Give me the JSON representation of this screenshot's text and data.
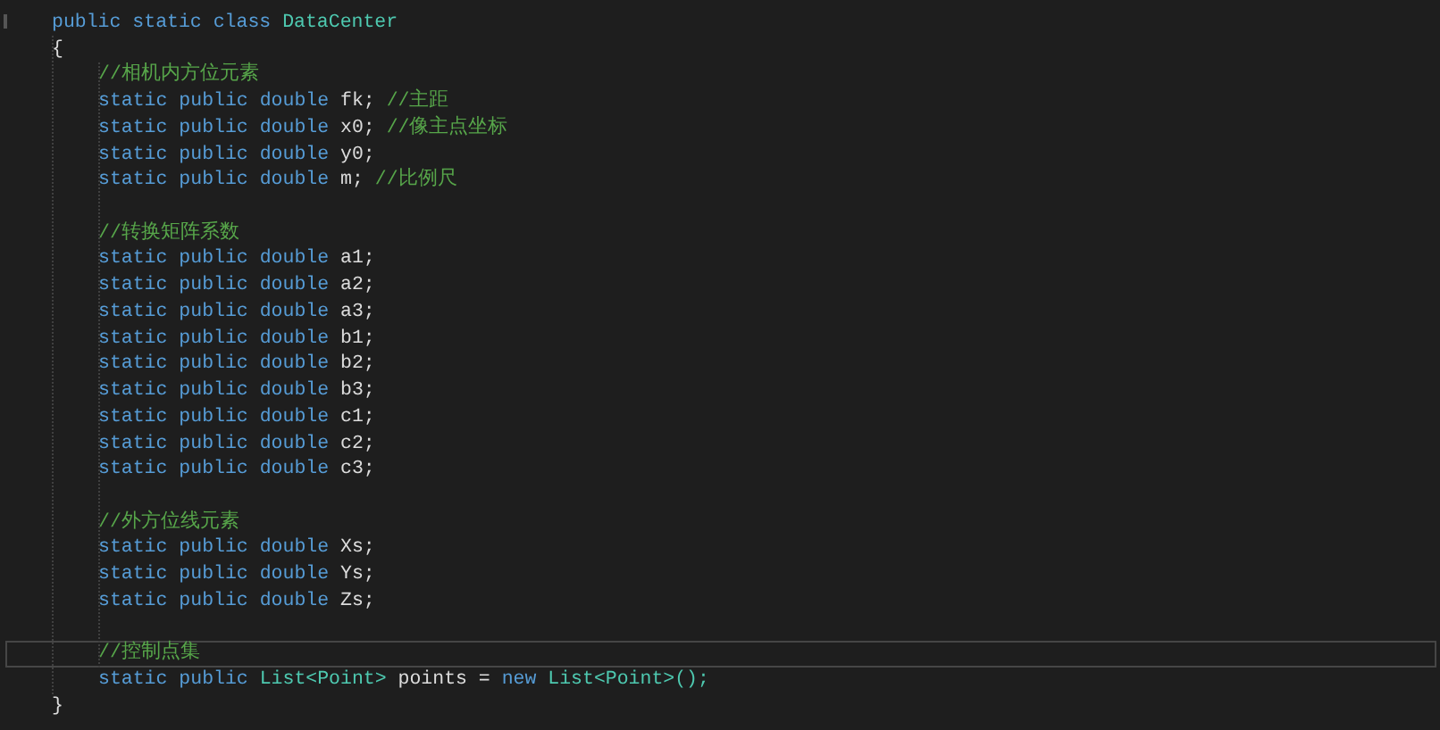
{
  "header": [
    {
      "kind": "keyword",
      "text": "public"
    },
    {
      "kind": "keyword",
      "text": "static"
    },
    {
      "kind": "keyword",
      "text": "class"
    },
    {
      "kind": "type",
      "text": "DataCenter"
    }
  ],
  "open": "{",
  "body": [
    {
      "kind": "code",
      "current": false,
      "tokens": [
        {
          "kind": "comment",
          "text": "//相机内方位元素"
        }
      ]
    },
    {
      "kind": "code",
      "current": false,
      "tokens": [
        {
          "kind": "keyword",
          "text": "static"
        },
        {
          "kind": "keyword",
          "text": "public"
        },
        {
          "kind": "keyword",
          "text": "double"
        },
        {
          "kind": "ident",
          "text": "fk;"
        },
        {
          "kind": "comment",
          "text": "//主距"
        }
      ]
    },
    {
      "kind": "code",
      "current": false,
      "tokens": [
        {
          "kind": "keyword",
          "text": "static"
        },
        {
          "kind": "keyword",
          "text": "public"
        },
        {
          "kind": "keyword",
          "text": "double"
        },
        {
          "kind": "ident",
          "text": "x0;"
        },
        {
          "kind": "comment",
          "text": "//像主点坐标"
        }
      ]
    },
    {
      "kind": "code",
      "current": false,
      "tokens": [
        {
          "kind": "keyword",
          "text": "static"
        },
        {
          "kind": "keyword",
          "text": "public"
        },
        {
          "kind": "keyword",
          "text": "double"
        },
        {
          "kind": "ident",
          "text": "y0;"
        }
      ]
    },
    {
      "kind": "code",
      "current": false,
      "tokens": [
        {
          "kind": "keyword",
          "text": "static"
        },
        {
          "kind": "keyword",
          "text": "public"
        },
        {
          "kind": "keyword",
          "text": "double"
        },
        {
          "kind": "ident",
          "text": "m;"
        },
        {
          "kind": "comment",
          "text": "//比例尺"
        }
      ]
    },
    {
      "kind": "blank"
    },
    {
      "kind": "code",
      "current": false,
      "tokens": [
        {
          "kind": "comment",
          "text": "//转换矩阵系数"
        }
      ]
    },
    {
      "kind": "code",
      "current": false,
      "tokens": [
        {
          "kind": "keyword",
          "text": "static"
        },
        {
          "kind": "keyword",
          "text": "public"
        },
        {
          "kind": "keyword",
          "text": "double"
        },
        {
          "kind": "ident",
          "text": "a1;"
        }
      ]
    },
    {
      "kind": "code",
      "current": false,
      "tokens": [
        {
          "kind": "keyword",
          "text": "static"
        },
        {
          "kind": "keyword",
          "text": "public"
        },
        {
          "kind": "keyword",
          "text": "double"
        },
        {
          "kind": "ident",
          "text": "a2;"
        }
      ]
    },
    {
      "kind": "code",
      "current": false,
      "tokens": [
        {
          "kind": "keyword",
          "text": "static"
        },
        {
          "kind": "keyword",
          "text": "public"
        },
        {
          "kind": "keyword",
          "text": "double"
        },
        {
          "kind": "ident",
          "text": "a3;"
        }
      ]
    },
    {
      "kind": "code",
      "current": false,
      "tokens": [
        {
          "kind": "keyword",
          "text": "static"
        },
        {
          "kind": "keyword",
          "text": "public"
        },
        {
          "kind": "keyword",
          "text": "double"
        },
        {
          "kind": "ident",
          "text": "b1;"
        }
      ]
    },
    {
      "kind": "code",
      "current": false,
      "tokens": [
        {
          "kind": "keyword",
          "text": "static"
        },
        {
          "kind": "keyword",
          "text": "public"
        },
        {
          "kind": "keyword",
          "text": "double"
        },
        {
          "kind": "ident",
          "text": "b2;"
        }
      ]
    },
    {
      "kind": "code",
      "current": false,
      "tokens": [
        {
          "kind": "keyword",
          "text": "static"
        },
        {
          "kind": "keyword",
          "text": "public"
        },
        {
          "kind": "keyword",
          "text": "double"
        },
        {
          "kind": "ident",
          "text": "b3;"
        }
      ]
    },
    {
      "kind": "code",
      "current": false,
      "tokens": [
        {
          "kind": "keyword",
          "text": "static"
        },
        {
          "kind": "keyword",
          "text": "public"
        },
        {
          "kind": "keyword",
          "text": "double"
        },
        {
          "kind": "ident",
          "text": "c1;"
        }
      ]
    },
    {
      "kind": "code",
      "current": false,
      "tokens": [
        {
          "kind": "keyword",
          "text": "static"
        },
        {
          "kind": "keyword",
          "text": "public"
        },
        {
          "kind": "keyword",
          "text": "double"
        },
        {
          "kind": "ident",
          "text": "c2;"
        }
      ]
    },
    {
      "kind": "code",
      "current": false,
      "tokens": [
        {
          "kind": "keyword",
          "text": "static"
        },
        {
          "kind": "keyword",
          "text": "public"
        },
        {
          "kind": "keyword",
          "text": "double"
        },
        {
          "kind": "ident",
          "text": "c3;"
        }
      ]
    },
    {
      "kind": "blank"
    },
    {
      "kind": "code",
      "current": false,
      "tokens": [
        {
          "kind": "comment",
          "text": "//外方位线元素"
        }
      ]
    },
    {
      "kind": "code",
      "current": false,
      "tokens": [
        {
          "kind": "keyword",
          "text": "static"
        },
        {
          "kind": "keyword",
          "text": "public"
        },
        {
          "kind": "keyword",
          "text": "double"
        },
        {
          "kind": "ident",
          "text": "Xs;"
        }
      ]
    },
    {
      "kind": "code",
      "current": false,
      "tokens": [
        {
          "kind": "keyword",
          "text": "static"
        },
        {
          "kind": "keyword",
          "text": "public"
        },
        {
          "kind": "keyword",
          "text": "double"
        },
        {
          "kind": "ident",
          "text": "Ys;"
        }
      ]
    },
    {
      "kind": "code",
      "current": false,
      "tokens": [
        {
          "kind": "keyword",
          "text": "static"
        },
        {
          "kind": "keyword",
          "text": "public"
        },
        {
          "kind": "keyword",
          "text": "double"
        },
        {
          "kind": "ident",
          "text": "Zs;"
        }
      ]
    },
    {
      "kind": "blank"
    },
    {
      "kind": "code",
      "current": true,
      "tokens": [
        {
          "kind": "comment",
          "text": "//控制点集"
        }
      ]
    },
    {
      "kind": "code",
      "current": false,
      "tokens": [
        {
          "kind": "keyword",
          "text": "static"
        },
        {
          "kind": "keyword",
          "text": "public"
        },
        {
          "kind": "type",
          "text": "List<Point>"
        },
        {
          "kind": "ident",
          "text": "points ="
        },
        {
          "kind": "keyword",
          "text": "new"
        },
        {
          "kind": "type",
          "text": "List<Point>();"
        }
      ]
    }
  ],
  "close": "}"
}
